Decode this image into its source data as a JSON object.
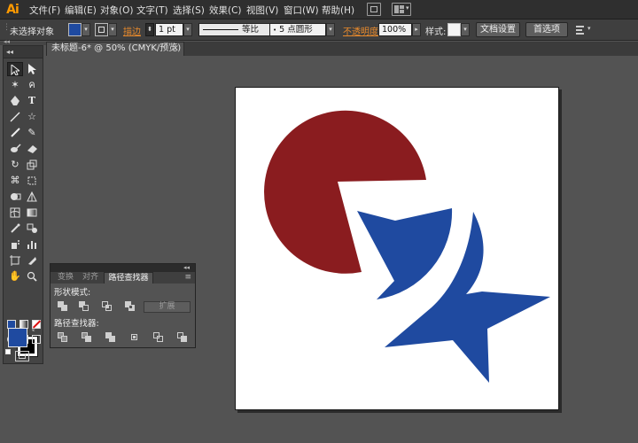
{
  "app": {
    "logo": "Ai"
  },
  "menu": {
    "items": [
      "文件(F)",
      "编辑(E)",
      "对象(O)",
      "文字(T)",
      "选择(S)",
      "效果(C)",
      "视图(V)",
      "窗口(W)",
      "帮助(H)"
    ]
  },
  "control_bar": {
    "selection_status": "未选择对象",
    "fill_color": "#1f4aa0",
    "stroke_label": "描边",
    "stroke_weight": "1 pt",
    "stroke_profile": "等比",
    "brush": "5 点圆形",
    "opacity_label": "不透明度",
    "opacity_value": "100%",
    "style_label": "样式:",
    "document_setup_button": "文档设置",
    "preferences_button": "首选项"
  },
  "document": {
    "tab_title": "未标题-6* @ 50% (CMYK/预览)",
    "tab_close": "×"
  },
  "tools": {
    "fill_color": "#1f4aa0",
    "stroke_color": "#000000"
  },
  "pathfinder_panel": {
    "tabs": [
      "变换",
      "对齐",
      "路径查找器"
    ],
    "active_tab": "路径查找器",
    "shape_modes_label": "形状模式:",
    "expand_button": "扩展",
    "pathfinders_label": "路径查找器:"
  },
  "artwork": {
    "pie_color": "#8a1c1f",
    "star_color": "#1f4aa0"
  }
}
